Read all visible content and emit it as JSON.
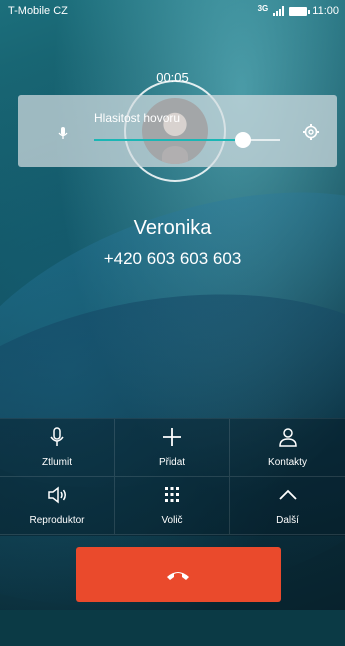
{
  "status_bar": {
    "carrier": "T-Mobile CZ",
    "network": "3G",
    "time": "11:00"
  },
  "call": {
    "timer": "00:05",
    "contact_name": "Veronika",
    "phone_number": "+420 603 603 603"
  },
  "volume_panel": {
    "title": "Hlasitost hovoru",
    "level_fraction": 0.8,
    "icons": [
      "microphone-icon",
      "gear-icon"
    ]
  },
  "controls": [
    {
      "label": "Ztlumit",
      "icon": "microphone-icon"
    },
    {
      "label": "Přidat",
      "icon": "plus-icon"
    },
    {
      "label": "Kontakty",
      "icon": "contacts-icon"
    },
    {
      "label": "Reproduktor",
      "icon": "speaker-icon"
    },
    {
      "label": "Volič",
      "icon": "dialpad-icon"
    },
    {
      "label": "Další",
      "icon": "chevron-up-icon"
    }
  ],
  "end_call": {
    "icon": "phone-hangup-icon"
  },
  "colors": {
    "accent": "#1bb6b5",
    "end_call": "#ea4a2c"
  }
}
